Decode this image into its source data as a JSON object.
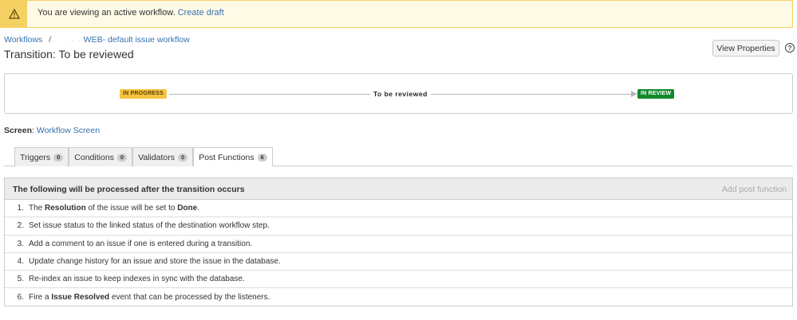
{
  "banner": {
    "text": "You are viewing an active workflow.",
    "link": "Create draft",
    "icon": "warning-icon",
    "color": "#f5d163"
  },
  "breadcrumb": {
    "root": "Workflows",
    "separator": "/",
    "workflow": "WEB- default issue workflow"
  },
  "page_title": "Transition: To be reviewed",
  "view_properties_label": "View Properties",
  "help_icon_label": "?",
  "diagram": {
    "from_status": "IN PROGRESS",
    "to_status": "IN REVIEW",
    "transition": "To be reviewed",
    "from_color": "#f5c342",
    "to_color": "#14892c"
  },
  "screen": {
    "label": "Screen",
    "value": "Workflow Screen"
  },
  "tabs": [
    {
      "label": "Triggers",
      "count": "0"
    },
    {
      "label": "Conditions",
      "count": "0"
    },
    {
      "label": "Validators",
      "count": "0"
    },
    {
      "label": "Post Functions",
      "count": "6"
    }
  ],
  "panel": {
    "title": "The following will be processed after the transition occurs",
    "action": "Add post function"
  },
  "post_functions": [
    {
      "num": "1.",
      "parts": [
        "The ",
        "Resolution",
        " of the issue will be set to ",
        "Done",
        "."
      ]
    },
    {
      "num": "2.",
      "parts": [
        "Set issue status to the linked status of the destination workflow step."
      ]
    },
    {
      "num": "3.",
      "parts": [
        "Add a comment to an issue if one is entered during a transition."
      ]
    },
    {
      "num": "4.",
      "parts": [
        "Update change history for an issue and store the issue in the database."
      ]
    },
    {
      "num": "5.",
      "parts": [
        "Re-index an issue to keep indexes in sync with the database."
      ]
    },
    {
      "num": "6.",
      "parts": [
        "Fire a ",
        "Issue Resolved",
        " event that can be processed by the listeners."
      ]
    }
  ]
}
